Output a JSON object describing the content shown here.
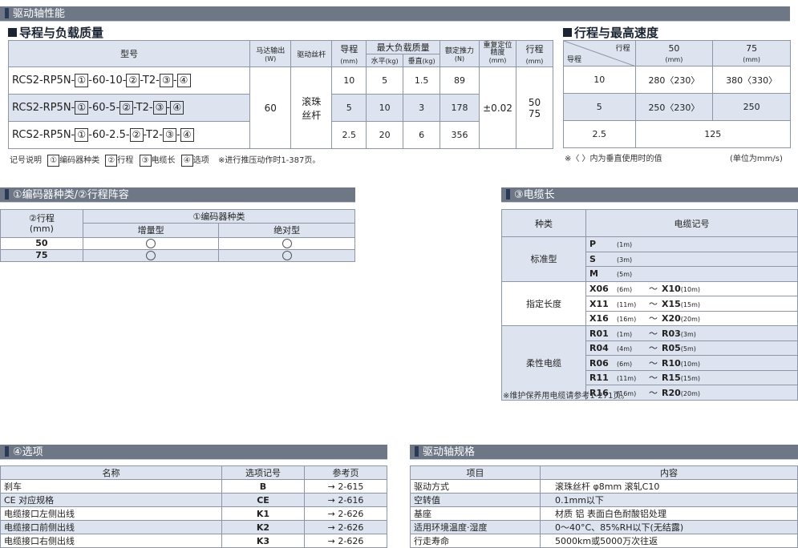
{
  "top_bar": {
    "title": "驱动轴性能"
  },
  "load_section": {
    "title": "导程与负载质量",
    "headers": {
      "model": "型号",
      "motor": "马达输出",
      "motor_unit": "(W)",
      "drive": "驱动丝杆",
      "lead": "导程",
      "lead_unit": "(mm)",
      "max_load": "最大负载质量",
      "horizontal": "水平",
      "horizontal_unit": "(kg)",
      "vertical": "垂直",
      "vertical_unit": "(kg)",
      "thrust": "额定推力",
      "thrust_unit": "(N)",
      "repeat": "重复定位精度",
      "repeat_unit": "(mm)",
      "stroke": "行程",
      "stroke_unit": "(mm)"
    },
    "model_parts": {
      "dash": "-",
      "b1": "①",
      "b2": "②",
      "b3": "③",
      "b4": "④",
      "t2": "-T2-"
    },
    "rows": [
      {
        "model_prefix": "RCS2-RP5N-",
        "model_mid": "-60-10-",
        "lead": "10",
        "horizontal": "5",
        "vertical": "1.5",
        "thrust": "89"
      },
      {
        "model_prefix": "RCS2-RP5N-",
        "model_mid": "-60-5-",
        "lead": "5",
        "horizontal": "10",
        "vertical": "3",
        "thrust": "178"
      },
      {
        "model_prefix": "RCS2-RP5N-",
        "model_mid": "-60-2.5-",
        "lead": "2.5",
        "horizontal": "20",
        "vertical": "6",
        "thrust": "356"
      }
    ],
    "motor": "60",
    "drive": "滚珠丝杆",
    "repeat": "±0.02",
    "stroke_a": "50",
    "stroke_b": "75",
    "legend": {
      "label": "记号说明",
      "n1": "①",
      "t1": "编码器种类",
      "n2": "②",
      "t2": "行程",
      "n3": "③",
      "t3": "电缆长",
      "n4": "④",
      "t4": "选项",
      "note": "※进行推压动作时1-387页。"
    }
  },
  "speed_section": {
    "title": "行程与最高速度",
    "corner_top": "行程",
    "corner_bottom": "导程",
    "cols": [
      {
        "v": "50",
        "u": "(mm)"
      },
      {
        "v": "75",
        "u": "(mm)"
      }
    ],
    "rows": [
      {
        "lead": "10",
        "c1": "280〈230〉",
        "c2": "380〈330〉"
      },
      {
        "lead": "5",
        "c1": "250〈230〉",
        "c2": "250"
      },
      {
        "lead": "2.5",
        "merged": "125"
      }
    ],
    "note_left": "※〈  〉内为垂直使用时的值",
    "note_right": "(单位为mm/s)"
  },
  "encoder_section": {
    "title": "①编码器种类/②行程阵容",
    "h_stroke": "②行程",
    "h_stroke_unit": "(mm)",
    "h_encoder": "①编码器种类",
    "h_inc": "增量型",
    "h_abs": "绝对型",
    "rows": [
      {
        "stroke": "50"
      },
      {
        "stroke": "75"
      }
    ]
  },
  "cable_section": {
    "title": "③电缆长",
    "h_type": "种类",
    "h_code": "电缆记号",
    "groups": [
      {
        "type": "标准型",
        "items": [
          {
            "a": "P",
            "au": "(1m)"
          },
          {
            "a": "S",
            "au": "(3m)"
          },
          {
            "a": "M",
            "au": "(5m)"
          }
        ]
      },
      {
        "type": "指定长度",
        "items": [
          {
            "a": "X06",
            "au": "(6m)",
            "b": "X10",
            "bu": "(10m)"
          },
          {
            "a": "X11",
            "au": "(11m)",
            "b": "X15",
            "bu": "(15m)"
          },
          {
            "a": "X16",
            "au": "(16m)",
            "b": "X20",
            "bu": "(20m)"
          }
        ]
      },
      {
        "type": "柔性电缆",
        "items": [
          {
            "a": "R01",
            "au": "(1m)",
            "b": "R03",
            "bu": "(3m)"
          },
          {
            "a": "R04",
            "au": "(4m)",
            "b": "R05",
            "bu": "(5m)"
          },
          {
            "a": "R06",
            "au": "(6m)",
            "b": "R10",
            "bu": "(10m)"
          },
          {
            "a": "R11",
            "au": "(11m)",
            "b": "R15",
            "bu": "(15m)"
          },
          {
            "a": "R16",
            "au": "(16m)",
            "b": "R20",
            "bu": "(20m)"
          }
        ]
      }
    ],
    "tilde": "～",
    "note": "※维护保养用电缆请参考1-271页。"
  },
  "options_section": {
    "title": "④选项",
    "headers": [
      "名称",
      "选项记号",
      "参考页"
    ],
    "rows": [
      {
        "name": "刹车",
        "code": "B",
        "page": "→ 2-615"
      },
      {
        "name": "CE 对应规格",
        "code": "CE",
        "page": "→ 2-616"
      },
      {
        "name": "电缆接口左侧出线",
        "code": "K1",
        "page": "→ 2-626"
      },
      {
        "name": "电缆接口前侧出线",
        "code": "K2",
        "page": "→ 2-626"
      },
      {
        "name": "电缆接口右侧出线",
        "code": "K3",
        "page": "→ 2-626"
      }
    ]
  },
  "spec_section": {
    "title": "驱动轴规格",
    "headers": [
      "项目",
      "内容"
    ],
    "rows": [
      {
        "item": "驱动方式",
        "value": "滚珠丝杆   φ8mm   滚轧C10"
      },
      {
        "item": "空转值",
        "value": "0.1mm以下"
      },
      {
        "item": "基座",
        "value": "材质 铝 表面白色耐酸铝处理"
      },
      {
        "item": "适用环境温度·湿度",
        "value": "0～40°C、85%RH以下(无结露)"
      },
      {
        "item": "行走寿命",
        "value": "5000km或5000万次往返"
      }
    ]
  }
}
